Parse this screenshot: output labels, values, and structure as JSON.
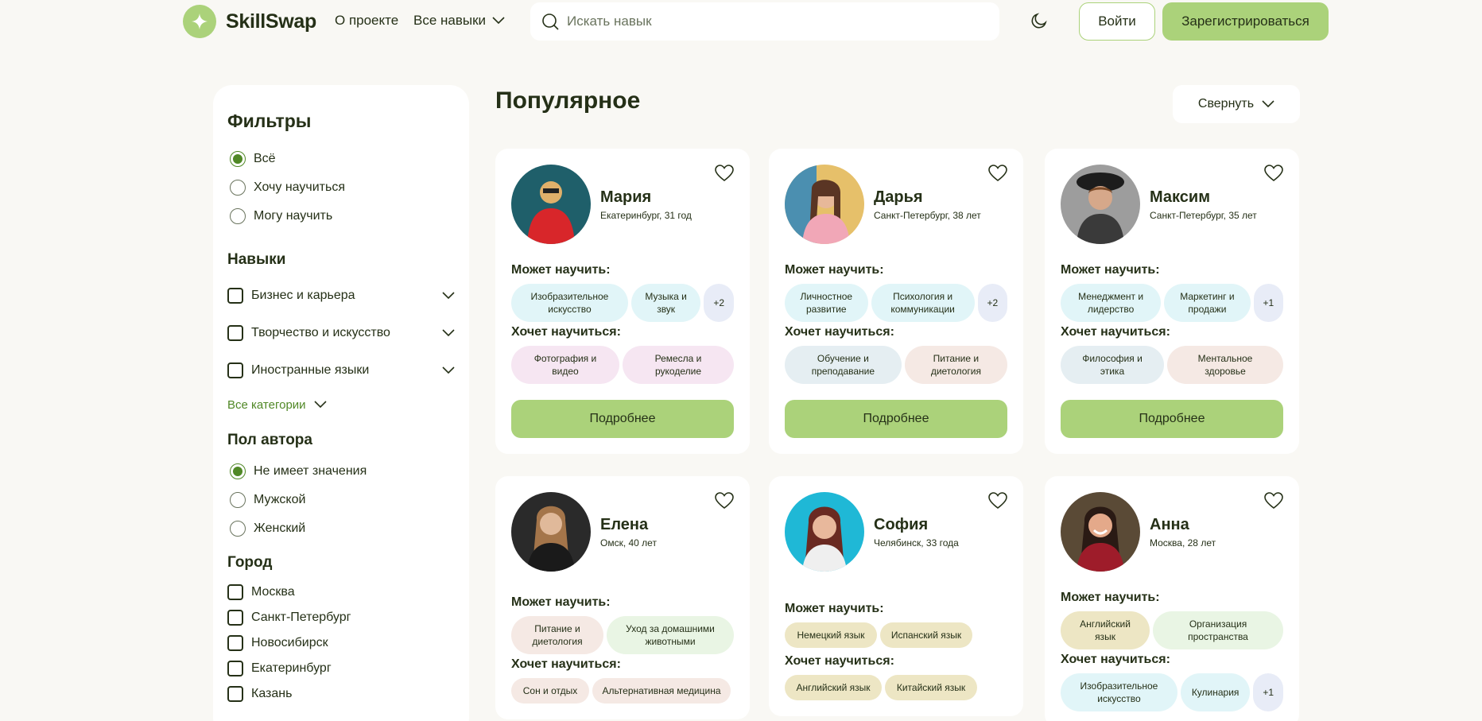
{
  "header": {
    "logo": "SkillSwap",
    "nav_about": "О проекте",
    "nav_skills": "Все навыки",
    "search_placeholder": "Искать навык",
    "login": "Войти",
    "register": "Зарегистрироваться"
  },
  "sidebar": {
    "title": "Фильтры",
    "mode_options": [
      {
        "label": "Всё",
        "selected": true
      },
      {
        "label": "Хочу научиться",
        "selected": false
      },
      {
        "label": "Могу научить",
        "selected": false
      }
    ],
    "skills_title": "Навыки",
    "skill_categories": [
      "Бизнес и карьера",
      "Творчество и искусство",
      "Иностранные языки"
    ],
    "all_categories": "Все категории",
    "gender_title": "Пол автора",
    "gender_options": [
      {
        "label": "Не имеет значения",
        "selected": true
      },
      {
        "label": "Мужской",
        "selected": false
      },
      {
        "label": "Женский",
        "selected": false
      }
    ],
    "city_title": "Город",
    "cities": [
      "Москва",
      "Санкт-Петербург",
      "Новосибирск",
      "Екатеринбург",
      "Казань"
    ]
  },
  "main": {
    "title": "Популярное",
    "collapse": "Свернуть",
    "can_teach_label": "Может научить:",
    "wants_learn_label": "Хочет научиться:",
    "details_label": "Подробнее"
  },
  "cards": [
    {
      "name": "Мария",
      "location": "Екатеринбург, 31 год",
      "teach": [
        "Изобразительное искусство",
        "Музыка и звук"
      ],
      "teach_more": "+2",
      "learn": [
        "Фотография и видео",
        "Ремесла и рукоделие"
      ]
    },
    {
      "name": "Дарья",
      "location": "Санкт-Петербург, 38 лет",
      "teach": [
        "Личностное развитие",
        "Психология и коммуникации"
      ],
      "teach_more": "+2",
      "learn": [
        "Обучение и преподавание",
        "Питание и диетология"
      ]
    },
    {
      "name": "Максим",
      "location": "Санкт-Петербург, 35 лет",
      "teach": [
        "Менеджмент и лидерство",
        "Маркетинг и продажи"
      ],
      "teach_more": "+1",
      "learn": [
        "Философия и этика",
        "Ментальное здоровье"
      ]
    },
    {
      "name": "Елена",
      "location": "Омск, 40 лет",
      "teach": [
        "Питание и диетология",
        "Уход за домашними животными"
      ],
      "learn": [
        "Сон и отдых",
        "Альтернативная медицина"
      ]
    },
    {
      "name": "София",
      "location": "Челябинск, 33 года",
      "teach": [
        "Немецкий язык",
        "Испанский язык"
      ],
      "learn": [
        "Английский язык",
        "Китайский язык"
      ]
    },
    {
      "name": "Анна",
      "location": "Москва, 28 лет",
      "teach": [
        "Английский язык",
        "Организация пространства"
      ],
      "learn": [
        "Изобразительное искусство",
        "Кулинария"
      ],
      "learn_more": "+1"
    }
  ],
  "colors": {
    "accent": "#abd27a",
    "accent_dark": "#508826",
    "background": "#f9f8f4",
    "text": "#253017"
  }
}
